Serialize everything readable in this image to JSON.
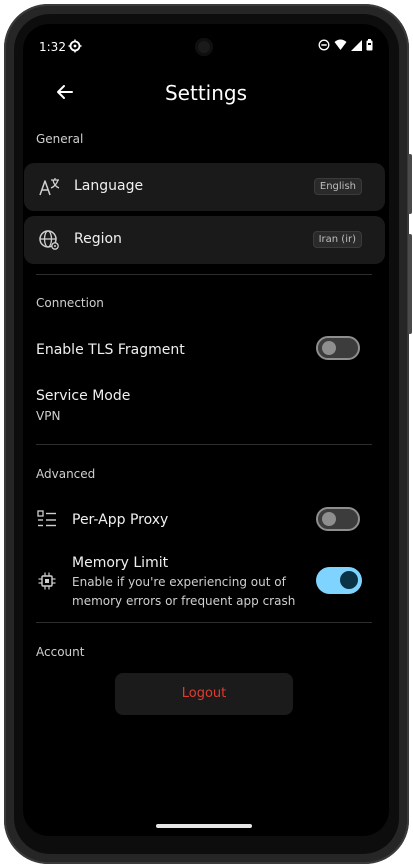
{
  "status_bar": {
    "time": "1:32"
  },
  "app_bar": {
    "title": "Settings"
  },
  "general": {
    "label": "General",
    "language": {
      "label": "Language",
      "value": "English"
    },
    "region": {
      "label": "Region",
      "value": "Iran (ir)"
    }
  },
  "connection": {
    "label": "Connection",
    "tls": {
      "label": "Enable TLS Fragment",
      "enabled": false
    },
    "service_mode": {
      "label": "Service Mode",
      "value": "VPN"
    }
  },
  "advanced": {
    "label": "Advanced",
    "per_app": {
      "label": "Per-App Proxy",
      "enabled": false
    },
    "memory_limit": {
      "label": "Memory Limit",
      "description_line1": "Enable if you're experiencing out of",
      "description_line2": "memory errors or frequent app crash",
      "enabled": true
    }
  },
  "account": {
    "label": "Account",
    "logout": "Logout"
  },
  "colors": {
    "accent": "#7fd3ff",
    "danger": "#e23b2e",
    "card": "#1a1a1a",
    "background": "#000000"
  }
}
